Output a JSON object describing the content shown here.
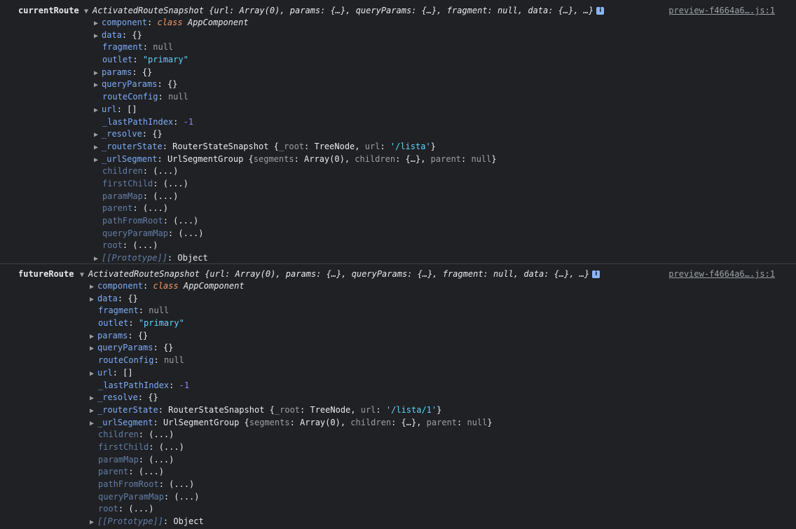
{
  "source_link": "preview-f4664a6….js:1",
  "info_glyph": "i",
  "entries": [
    {
      "label": "currentRoute",
      "summary_class": "ActivatedRouteSnapshot",
      "summary": "{url: Array(0), params: {…}, queryParams: {…}, fragment: null, data: {…}, …}",
      "rows": {
        "component": {
          "key": "component",
          "kw": "class",
          "value": "AppComponent"
        },
        "data": {
          "key": "data",
          "value": "{}"
        },
        "fragment": {
          "key": "fragment",
          "value": "null"
        },
        "outlet": {
          "key": "outlet",
          "value": "\"primary\""
        },
        "params": {
          "key": "params",
          "value": "{}"
        },
        "queryParams": {
          "key": "queryParams",
          "value": "{}"
        },
        "routeConfig": {
          "key": "routeConfig",
          "value": "null"
        },
        "url": {
          "key": "url",
          "value": "[]"
        },
        "lastPathIndex": {
          "key": "_lastPathIndex",
          "value": "-1"
        },
        "resolve": {
          "key": "_resolve",
          "value": "{}"
        },
        "routerState": {
          "key": "_routerState",
          "type": "RouterStateSnapshot",
          "open": "{",
          "k1": "_root",
          "v1": "TreeNode",
          "k2": "url",
          "v2": "'/lista'",
          "close": "}"
        },
        "urlSegment": {
          "key": "_urlSegment",
          "type": "UrlSegmentGroup",
          "open": "{",
          "k1": "segments",
          "v1": "Array(0)",
          "k2": "children",
          "v2": "{…}",
          "k3": "parent",
          "v3": "null",
          "close": "}"
        },
        "children": {
          "key": "children",
          "value": "(...)"
        },
        "firstChild": {
          "key": "firstChild",
          "value": "(...)"
        },
        "paramMap": {
          "key": "paramMap",
          "value": "(...)"
        },
        "parent": {
          "key": "parent",
          "value": "(...)"
        },
        "pathFromRoot": {
          "key": "pathFromRoot",
          "value": "(...)"
        },
        "queryParamMap": {
          "key": "queryParamMap",
          "value": "(...)"
        },
        "root": {
          "key": "root",
          "value": "(...)"
        },
        "prototype": {
          "key": "[[Prototype]]",
          "value": "Object"
        }
      }
    },
    {
      "label": "futureRoute",
      "summary_class": "ActivatedRouteSnapshot",
      "summary": "{url: Array(0), params: {…}, queryParams: {…}, fragment: null, data: {…}, …}",
      "rows": {
        "component": {
          "key": "component",
          "kw": "class",
          "value": "AppComponent"
        },
        "data": {
          "key": "data",
          "value": "{}"
        },
        "fragment": {
          "key": "fragment",
          "value": "null"
        },
        "outlet": {
          "key": "outlet",
          "value": "\"primary\""
        },
        "params": {
          "key": "params",
          "value": "{}"
        },
        "queryParams": {
          "key": "queryParams",
          "value": "{}"
        },
        "routeConfig": {
          "key": "routeConfig",
          "value": "null"
        },
        "url": {
          "key": "url",
          "value": "[]"
        },
        "lastPathIndex": {
          "key": "_lastPathIndex",
          "value": "-1"
        },
        "resolve": {
          "key": "_resolve",
          "value": "{}"
        },
        "routerState": {
          "key": "_routerState",
          "type": "RouterStateSnapshot",
          "open": "{",
          "k1": "_root",
          "v1": "TreeNode",
          "k2": "url",
          "v2": "'/lista/1'",
          "close": "}"
        },
        "urlSegment": {
          "key": "_urlSegment",
          "type": "UrlSegmentGroup",
          "open": "{",
          "k1": "segments",
          "v1": "Array(0)",
          "k2": "children",
          "v2": "{…}",
          "k3": "parent",
          "v3": "null",
          "close": "}"
        },
        "children": {
          "key": "children",
          "value": "(...)"
        },
        "firstChild": {
          "key": "firstChild",
          "value": "(...)"
        },
        "paramMap": {
          "key": "paramMap",
          "value": "(...)"
        },
        "parent": {
          "key": "parent",
          "value": "(...)"
        },
        "pathFromRoot": {
          "key": "pathFromRoot",
          "value": "(...)"
        },
        "queryParamMap": {
          "key": "queryParamMap",
          "value": "(...)"
        },
        "root": {
          "key": "root",
          "value": "(...)"
        },
        "prototype": {
          "key": "[[Prototype]]",
          "value": "Object"
        }
      }
    }
  ],
  "icons": {
    "expanded": "triangle-down-icon",
    "collapsed": "triangle-right-icon",
    "info": "info-icon"
  },
  "colors": {
    "background": "#202124",
    "key": "#7cacf8",
    "string": "#5cd5fb",
    "number": "#9980ff",
    "keyword": "#f29766",
    "null": "#9aa0a6"
  }
}
